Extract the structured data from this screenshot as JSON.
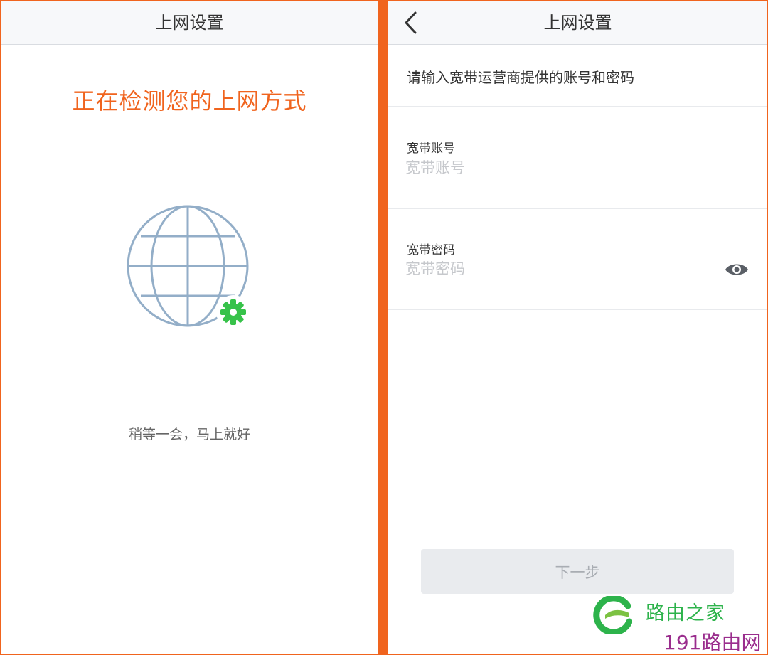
{
  "colors": {
    "accent": "#f0641e",
    "globe_stroke": "#93aec8",
    "gear": "#37c24a",
    "eye": "#5a5f66",
    "watermark_green": "#2db34b",
    "watermark_purple": "#9a2d8d"
  },
  "left_screen": {
    "title": "上网设置",
    "detect_heading": "正在检测您的上网方式",
    "wait_text": "稍等一会，马上就好",
    "icons": [
      "globe-icon",
      "gear-icon"
    ]
  },
  "right_screen": {
    "title": "上网设置",
    "back_icon": "chevron-left-icon",
    "hint": "请输入宽带运营商提供的账号和密码",
    "account": {
      "label": "宽带账号",
      "value": "",
      "placeholder": "宽带账号"
    },
    "password": {
      "label": "宽带密码",
      "value": "",
      "placeholder": "宽带密码",
      "toggle_icon": "eye-icon"
    },
    "next_label": "下一步"
  },
  "watermark": {
    "brand": "路由之家",
    "site": "191路由网"
  }
}
